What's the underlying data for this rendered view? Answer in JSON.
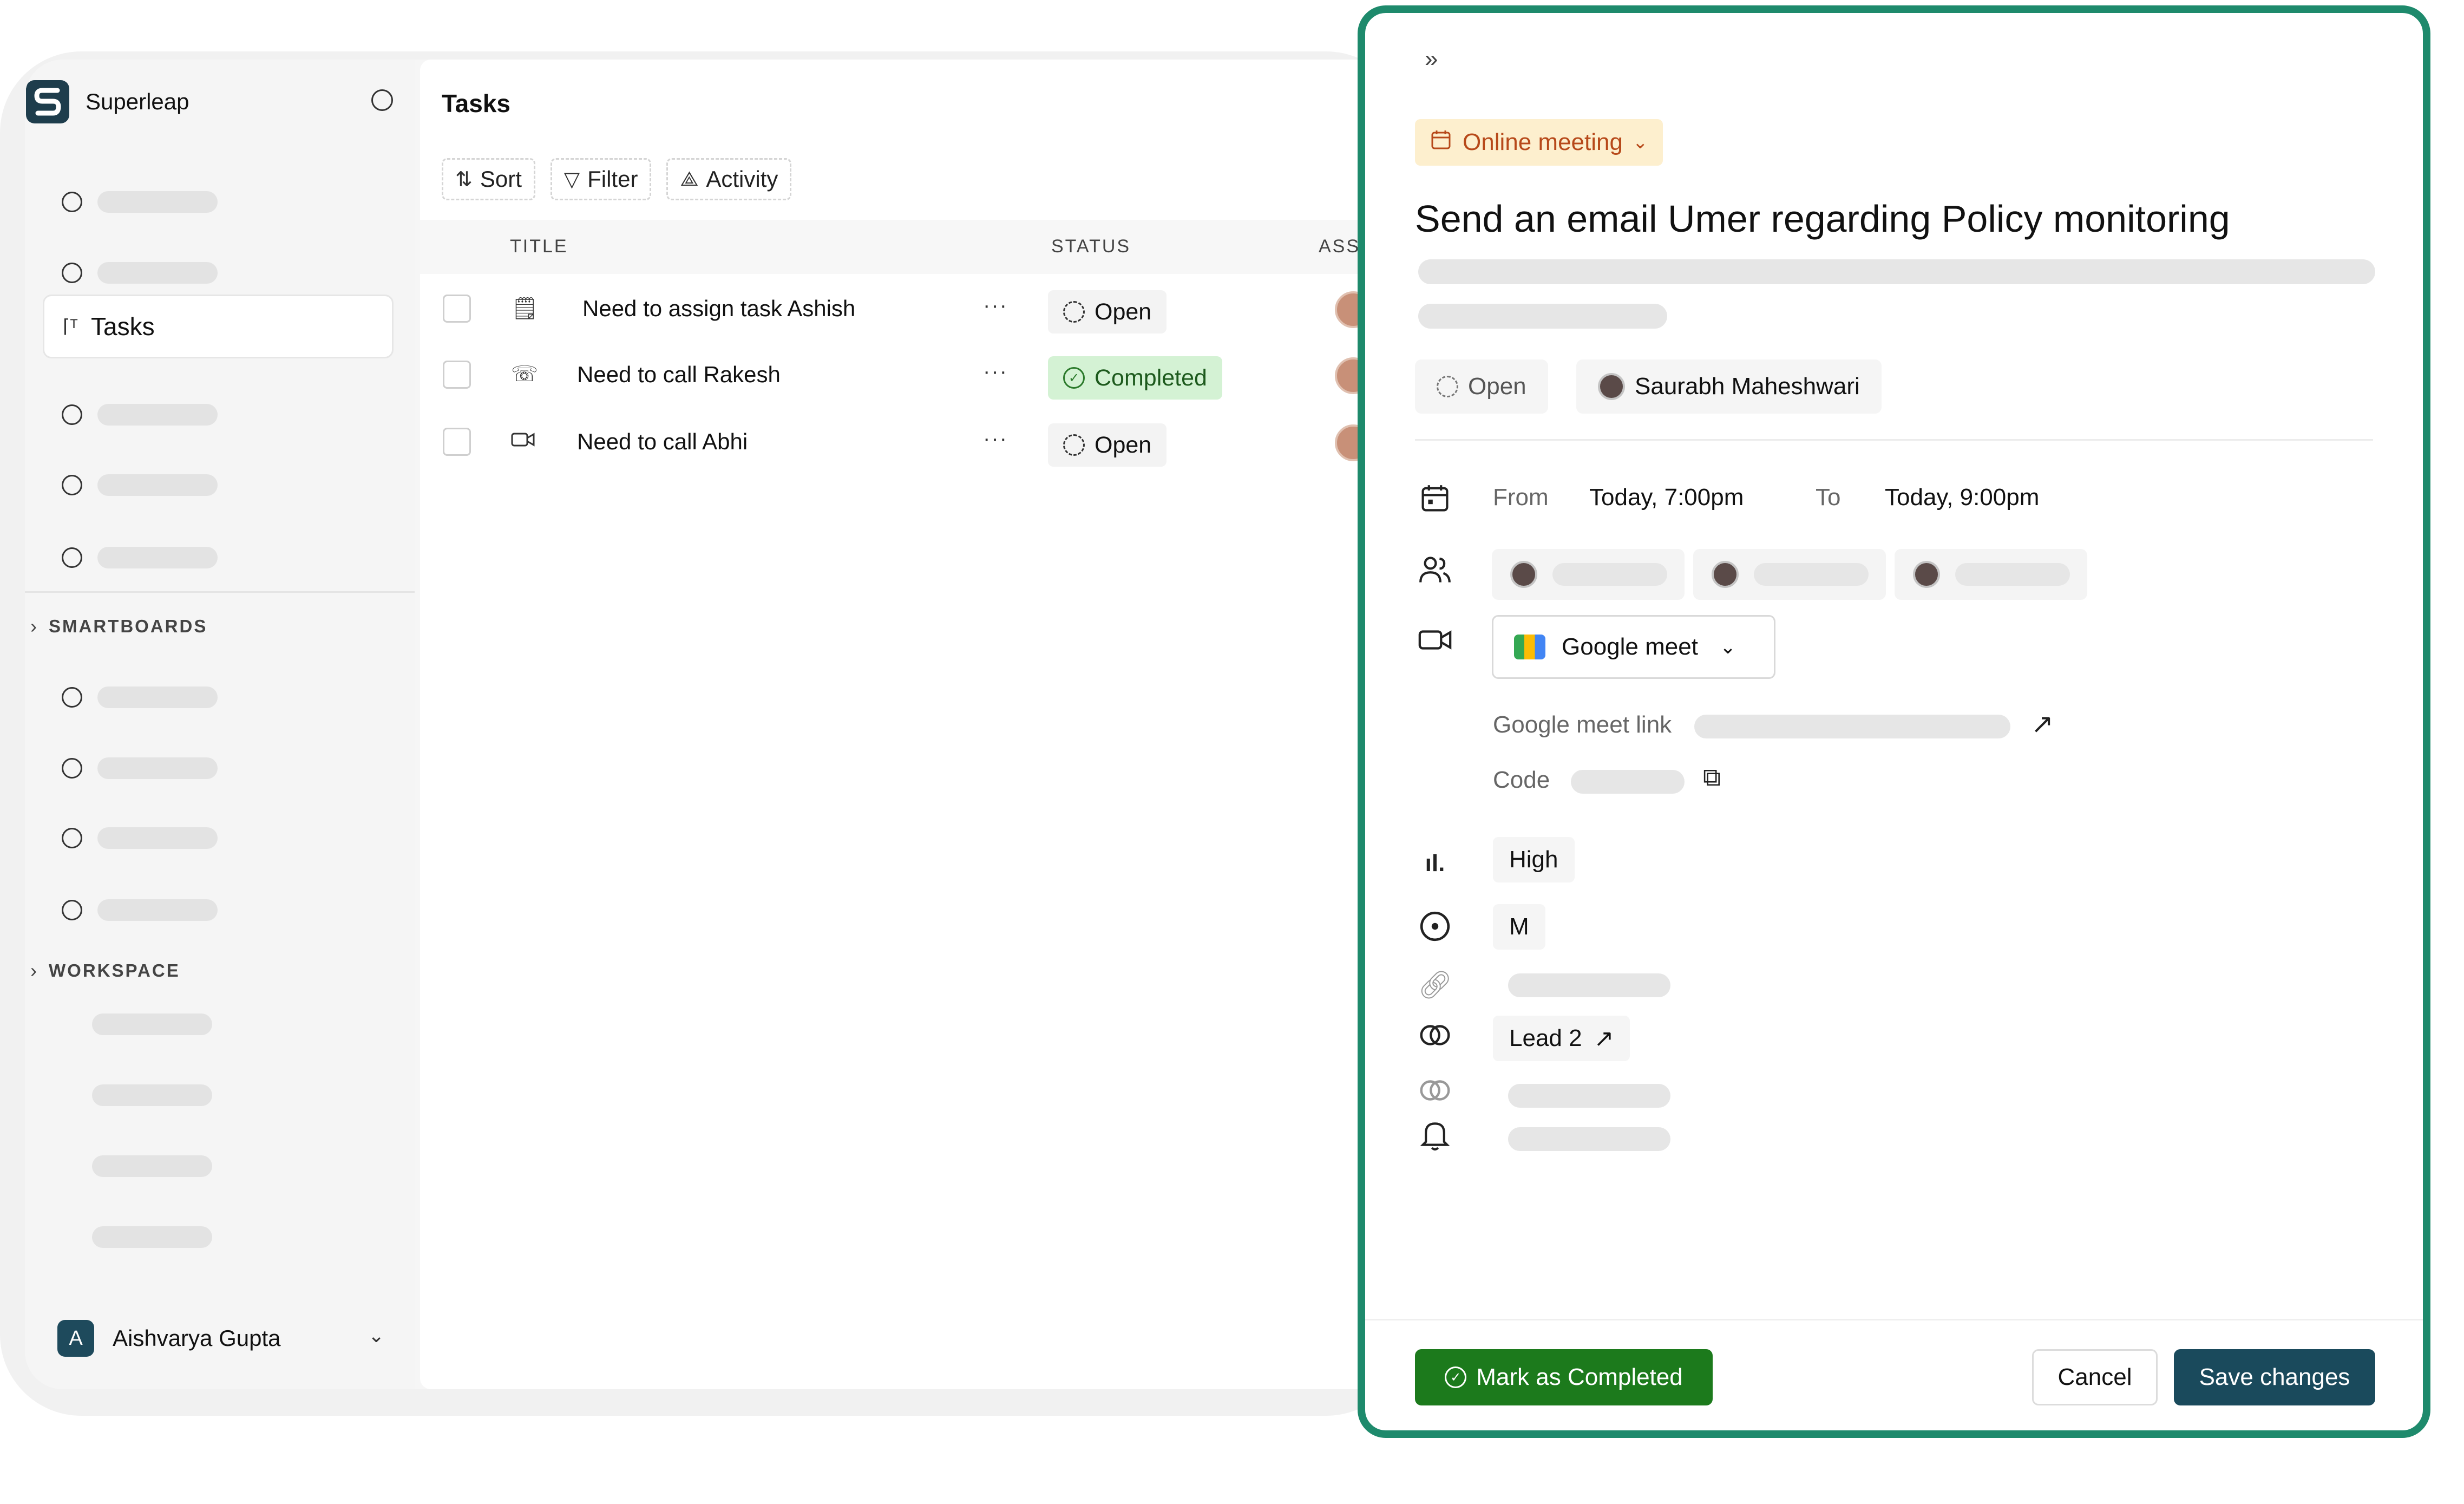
{
  "app": {
    "name": "Superleap"
  },
  "sidebar": {
    "tasks_label": "Tasks",
    "sections": {
      "smartboards": "SMARTBOARDS",
      "workspace": "WORKSPACE"
    },
    "user": {
      "initial": "A",
      "name": "Aishvarya Gupta"
    }
  },
  "main": {
    "title": "Tasks",
    "toolbar": {
      "sort": "Sort",
      "filter": "Filter",
      "activity": "Activity"
    },
    "columns": {
      "title": "TITLE",
      "status": "STATUS",
      "assignee": "ASSI"
    },
    "rows": [
      {
        "title": "Need to assign task Ashish",
        "icon": "task-icon",
        "status": "Open",
        "more": "···"
      },
      {
        "title": "Need to call Rakesh",
        "icon": "phone-call-icon",
        "status": "Completed",
        "more": "···"
      },
      {
        "title": "Need to call Abhi",
        "icon": "video-icon",
        "status": "Open",
        "more": "···"
      }
    ]
  },
  "panel": {
    "collapse": "»",
    "type_label": "Online meeting",
    "title": "Send an email Umer regarding Policy monitoring",
    "status": "Open",
    "assignee": "Saurabh Maheshwari",
    "from_label": "From",
    "from_value": "Today, 7:00pm",
    "to_label": "To",
    "to_value": "Today, 9:00pm",
    "meeting_app": "Google meet",
    "meet_link_label": "Google meet link",
    "code_label": "Code",
    "priority": "High",
    "owner_initial": "M",
    "linked_record": "Lead 2",
    "buttons": {
      "mark_completed": "Mark as Completed",
      "cancel": "Cancel",
      "save": "Save changes"
    }
  },
  "colors": {
    "accent": "#1e8a6c",
    "primary_button": "#1a4a5c",
    "success_button": "#1c7a1c",
    "chip_bg": "#fdefce",
    "chip_text": "#b7491a"
  }
}
